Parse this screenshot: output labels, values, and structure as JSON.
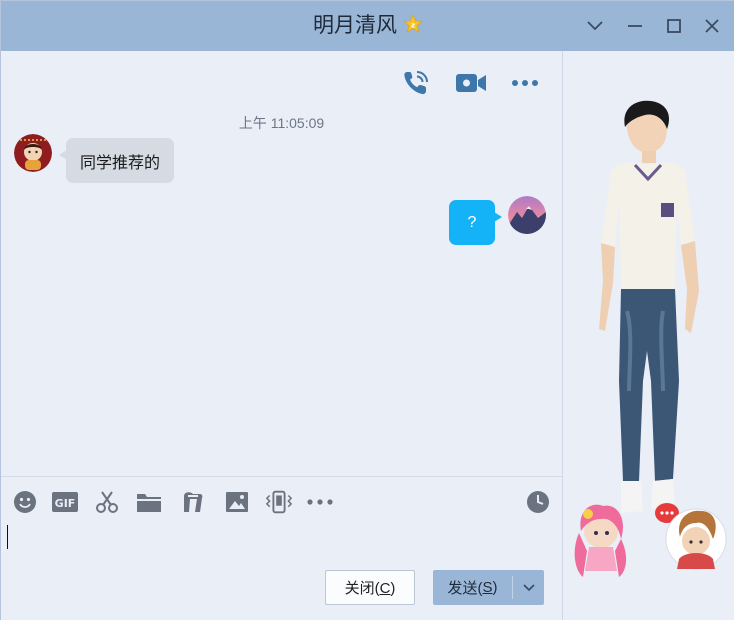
{
  "window": {
    "title": "明月清风"
  },
  "colors": {
    "titlebar": "#9ab6d6",
    "background": "#e9eef7",
    "icon_blue": "#3f77aa",
    "sent_bubble": "#14b3f7",
    "received_bubble": "#d5dae3"
  },
  "top_tools": [
    {
      "icon": "voice-call-icon"
    },
    {
      "icon": "video-call-icon"
    },
    {
      "icon": "more-icon"
    }
  ],
  "conversation": {
    "timestamp": "上午 11:05:09",
    "messages": [
      {
        "from": "contact",
        "text": "同学推荐的"
      },
      {
        "from": "me",
        "text": "?"
      }
    ]
  },
  "toolbar": {
    "icons": [
      "emoji-icon",
      "gif-icon",
      "screenshot-scissors-icon",
      "folder-icon",
      "music-icon",
      "image-icon",
      "shake-icon",
      "more-icon",
      "history-clock-icon"
    ]
  },
  "input": {
    "value": ""
  },
  "buttons": {
    "close": {
      "text": "关闭(",
      "key": "C",
      "end": ")"
    },
    "send": {
      "text": "发送(",
      "key": "S",
      "end": ")"
    }
  }
}
